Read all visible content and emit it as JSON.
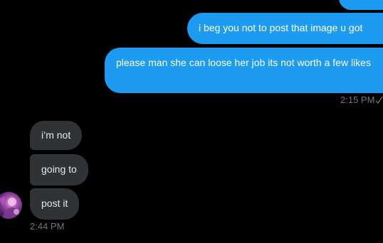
{
  "conversation": {
    "sent_messages": [
      {
        "text": ""
      },
      {
        "text": "i beg you not to post that image u got"
      },
      {
        "text": "please man she can loose her job its not worth a few likes"
      }
    ],
    "sent_time": "2:15 PM",
    "sent_status_icon": "check-icon",
    "received_messages": [
      {
        "text": "i’m not"
      },
      {
        "text": "going to"
      },
      {
        "text": "post it"
      }
    ],
    "received_time": "2:44 PM"
  },
  "colors": {
    "background": "#000000",
    "sent_bubble": "#1d9bf0",
    "received_bubble": "#2f3336",
    "timestamp": "#71767b"
  }
}
